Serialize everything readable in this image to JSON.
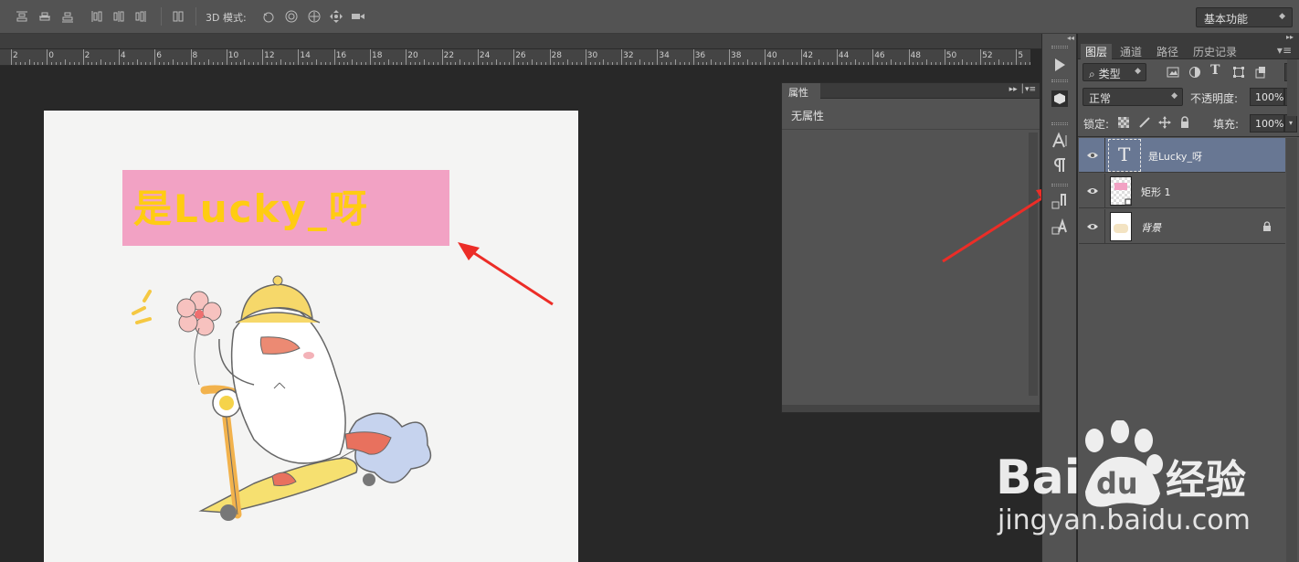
{
  "options_bar": {
    "mode_label": "3D 模式:",
    "workspace": "基本功能"
  },
  "ruler": {
    "labels": [
      "2",
      "0",
      "2",
      "4",
      "6",
      "8",
      "10",
      "12",
      "14",
      "16",
      "18",
      "20",
      "22",
      "24",
      "26",
      "28",
      "30",
      "32",
      "34",
      "36",
      "38",
      "40",
      "42",
      "44",
      "46",
      "48",
      "50",
      "52",
      "5"
    ]
  },
  "canvas": {
    "title_text": "是Lucky_呀"
  },
  "properties_panel": {
    "tab_label": "属性",
    "empty_text": "无属性"
  },
  "layers_panel": {
    "tabs": [
      "图层",
      "通道",
      "路径",
      "历史记录"
    ],
    "filter_type": "类型",
    "blend_mode": "正常",
    "opacity_label": "不透明度:",
    "opacity_value": "100%",
    "lock_label": "锁定:",
    "fill_label": "填充:",
    "fill_value": "100%",
    "layers": [
      {
        "name": "是Lucky_呀",
        "kind": "text",
        "selected": true
      },
      {
        "name": "矩形 1",
        "kind": "shape",
        "selected": false
      },
      {
        "name": "背景",
        "kind": "background",
        "selected": false,
        "locked": true
      }
    ]
  },
  "watermark": {
    "brand": "Bai du 经验",
    "url": "jingyan.baidu.com"
  },
  "colors": {
    "ui_panel": "#535353",
    "canvas_bg": "#282828",
    "selected_layer": "#687793",
    "pink_box": "#f2a2c4",
    "title_yellow": "#ffcc12",
    "arrow_red": "#ec2d27"
  }
}
